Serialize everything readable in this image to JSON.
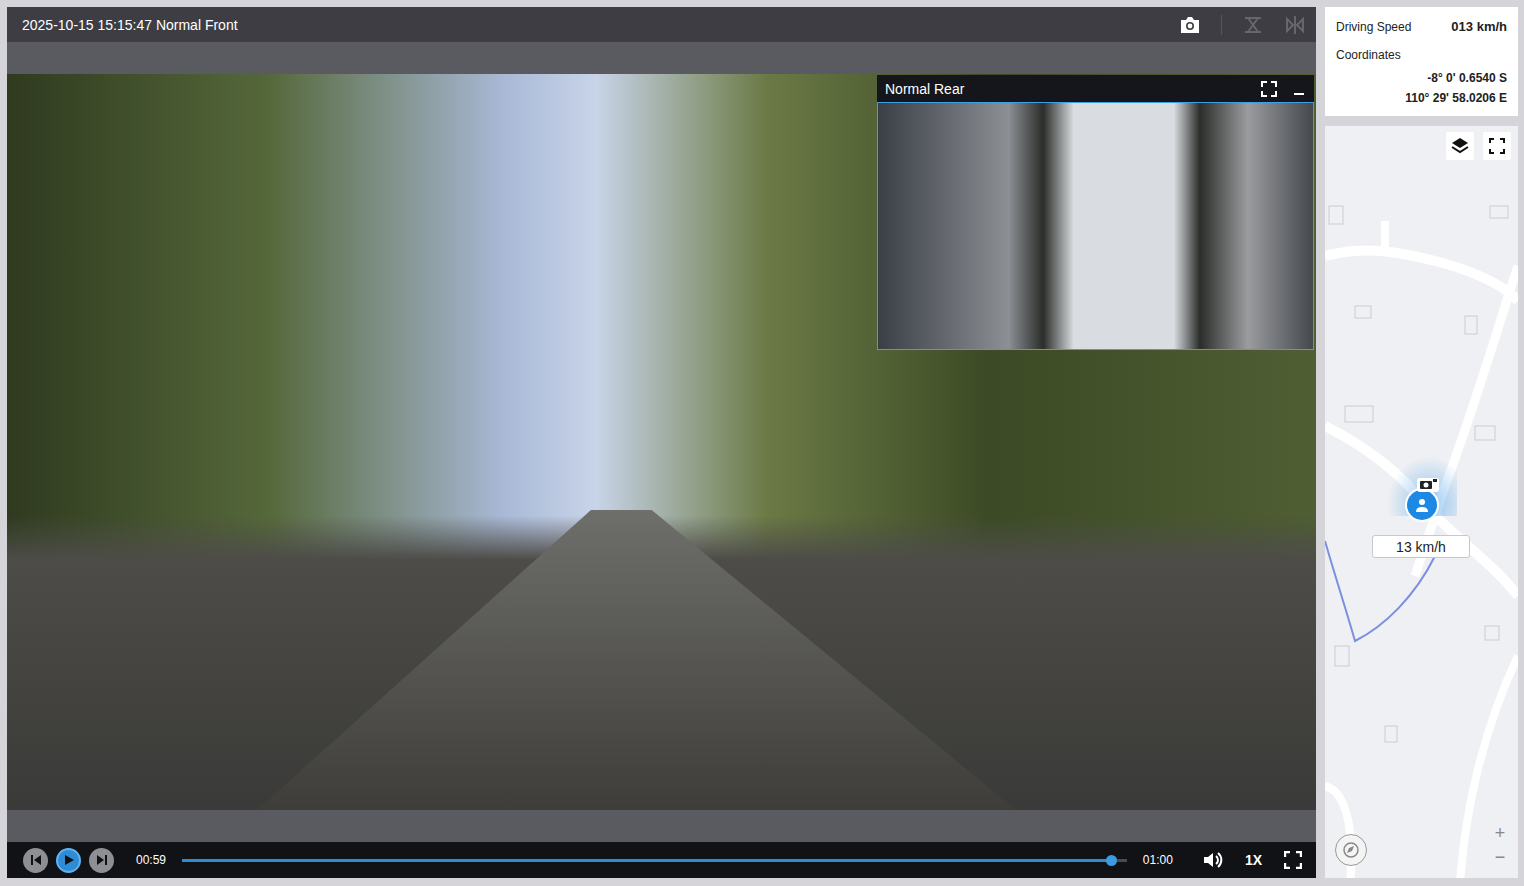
{
  "viewer": {
    "title": "2025-10-15 15:15:47 Normal Front"
  },
  "rear_view": {
    "title": "Normal Rear"
  },
  "playback": {
    "current": "00:59",
    "duration": "01:00",
    "level": 0.984,
    "speed": "1X",
    "playing": false
  },
  "info": {
    "speed_label": "Driving Speed",
    "speed": "013 km/h",
    "coords_label": "Coordinates",
    "latitude": "-8° 0' 0.6540 S",
    "longitude": "110° 29' 58.0206 E"
  },
  "map": {
    "marker_label": "13 km/h",
    "zoom_in": "+",
    "zoom_out": "−"
  }
}
